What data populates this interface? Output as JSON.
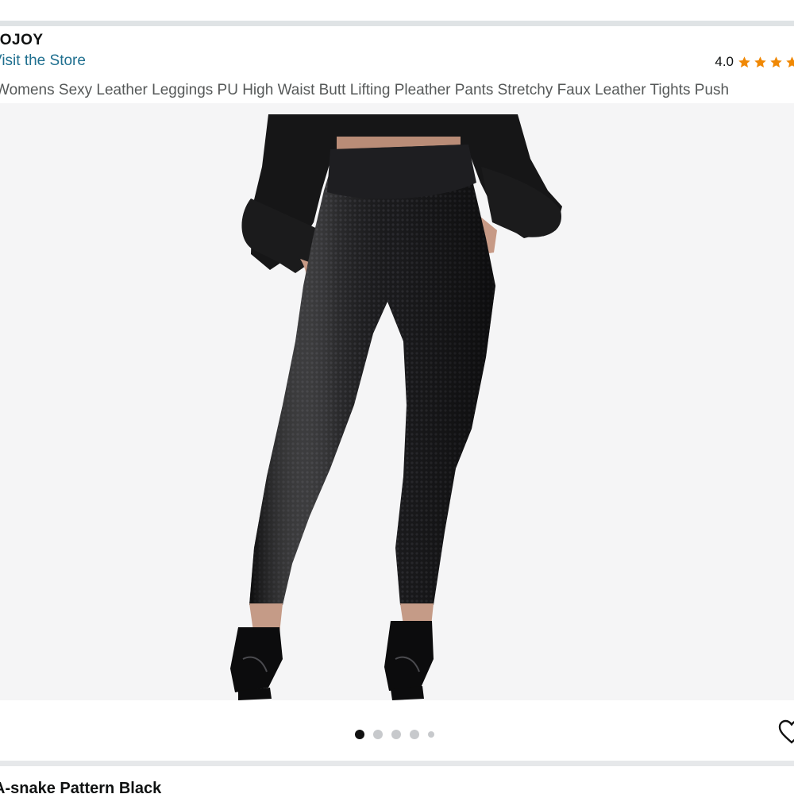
{
  "header": {
    "brand": "IOJOY",
    "store_link": "Visit the Store",
    "rating_value": "4.0",
    "stars": 4
  },
  "product": {
    "title": "Womens Sexy Leather Leggings PU High Waist Butt Lifting Pleather Pants Stretchy Faux Leather Tights Push",
    "image_alt": "Black high waist faux leather leggings worn with black blouse and heels"
  },
  "carousel": {
    "dot_count": 5,
    "active_index": 0
  },
  "variant": {
    "selected_label": "A-snake Pattern Black"
  },
  "colors": {
    "link": "#1f6f8f",
    "star": "#f08804",
    "dot_active": "#111111",
    "dot_inactive": "#c7c9cc",
    "image_bg": "#f5f5f6"
  },
  "icons": [
    "star-icon",
    "heart-icon"
  ]
}
